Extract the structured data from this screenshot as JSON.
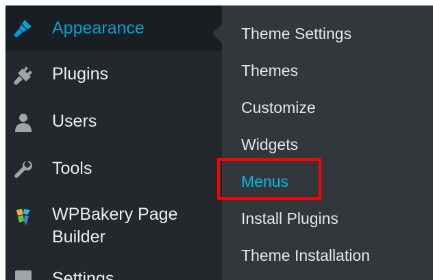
{
  "sidebar": {
    "items": [
      {
        "label": "Appearance",
        "icon": "paintbrush-icon",
        "active": true
      },
      {
        "label": "Plugins",
        "icon": "plug-icon"
      },
      {
        "label": "Users",
        "icon": "user-icon"
      },
      {
        "label": "Tools",
        "icon": "wrench-icon"
      },
      {
        "label_line1": "WPBakery Page",
        "label_line2": "Builder",
        "icon": "wpbakery-icon"
      },
      {
        "label": "Settings",
        "icon": "settings-icon"
      }
    ]
  },
  "submenu": {
    "items": [
      {
        "label": "Theme Settings"
      },
      {
        "label": "Themes"
      },
      {
        "label": "Customize"
      },
      {
        "label": "Widgets"
      },
      {
        "label": "Menus",
        "current": true
      },
      {
        "label": "Install Plugins"
      },
      {
        "label": "Theme Installation"
      }
    ]
  },
  "colors": {
    "sidebar_bg": "#23282d",
    "active_bg": "#191e23",
    "submenu_bg": "#32373c",
    "accent": "#00a0d2",
    "highlight": "#ff0000"
  }
}
